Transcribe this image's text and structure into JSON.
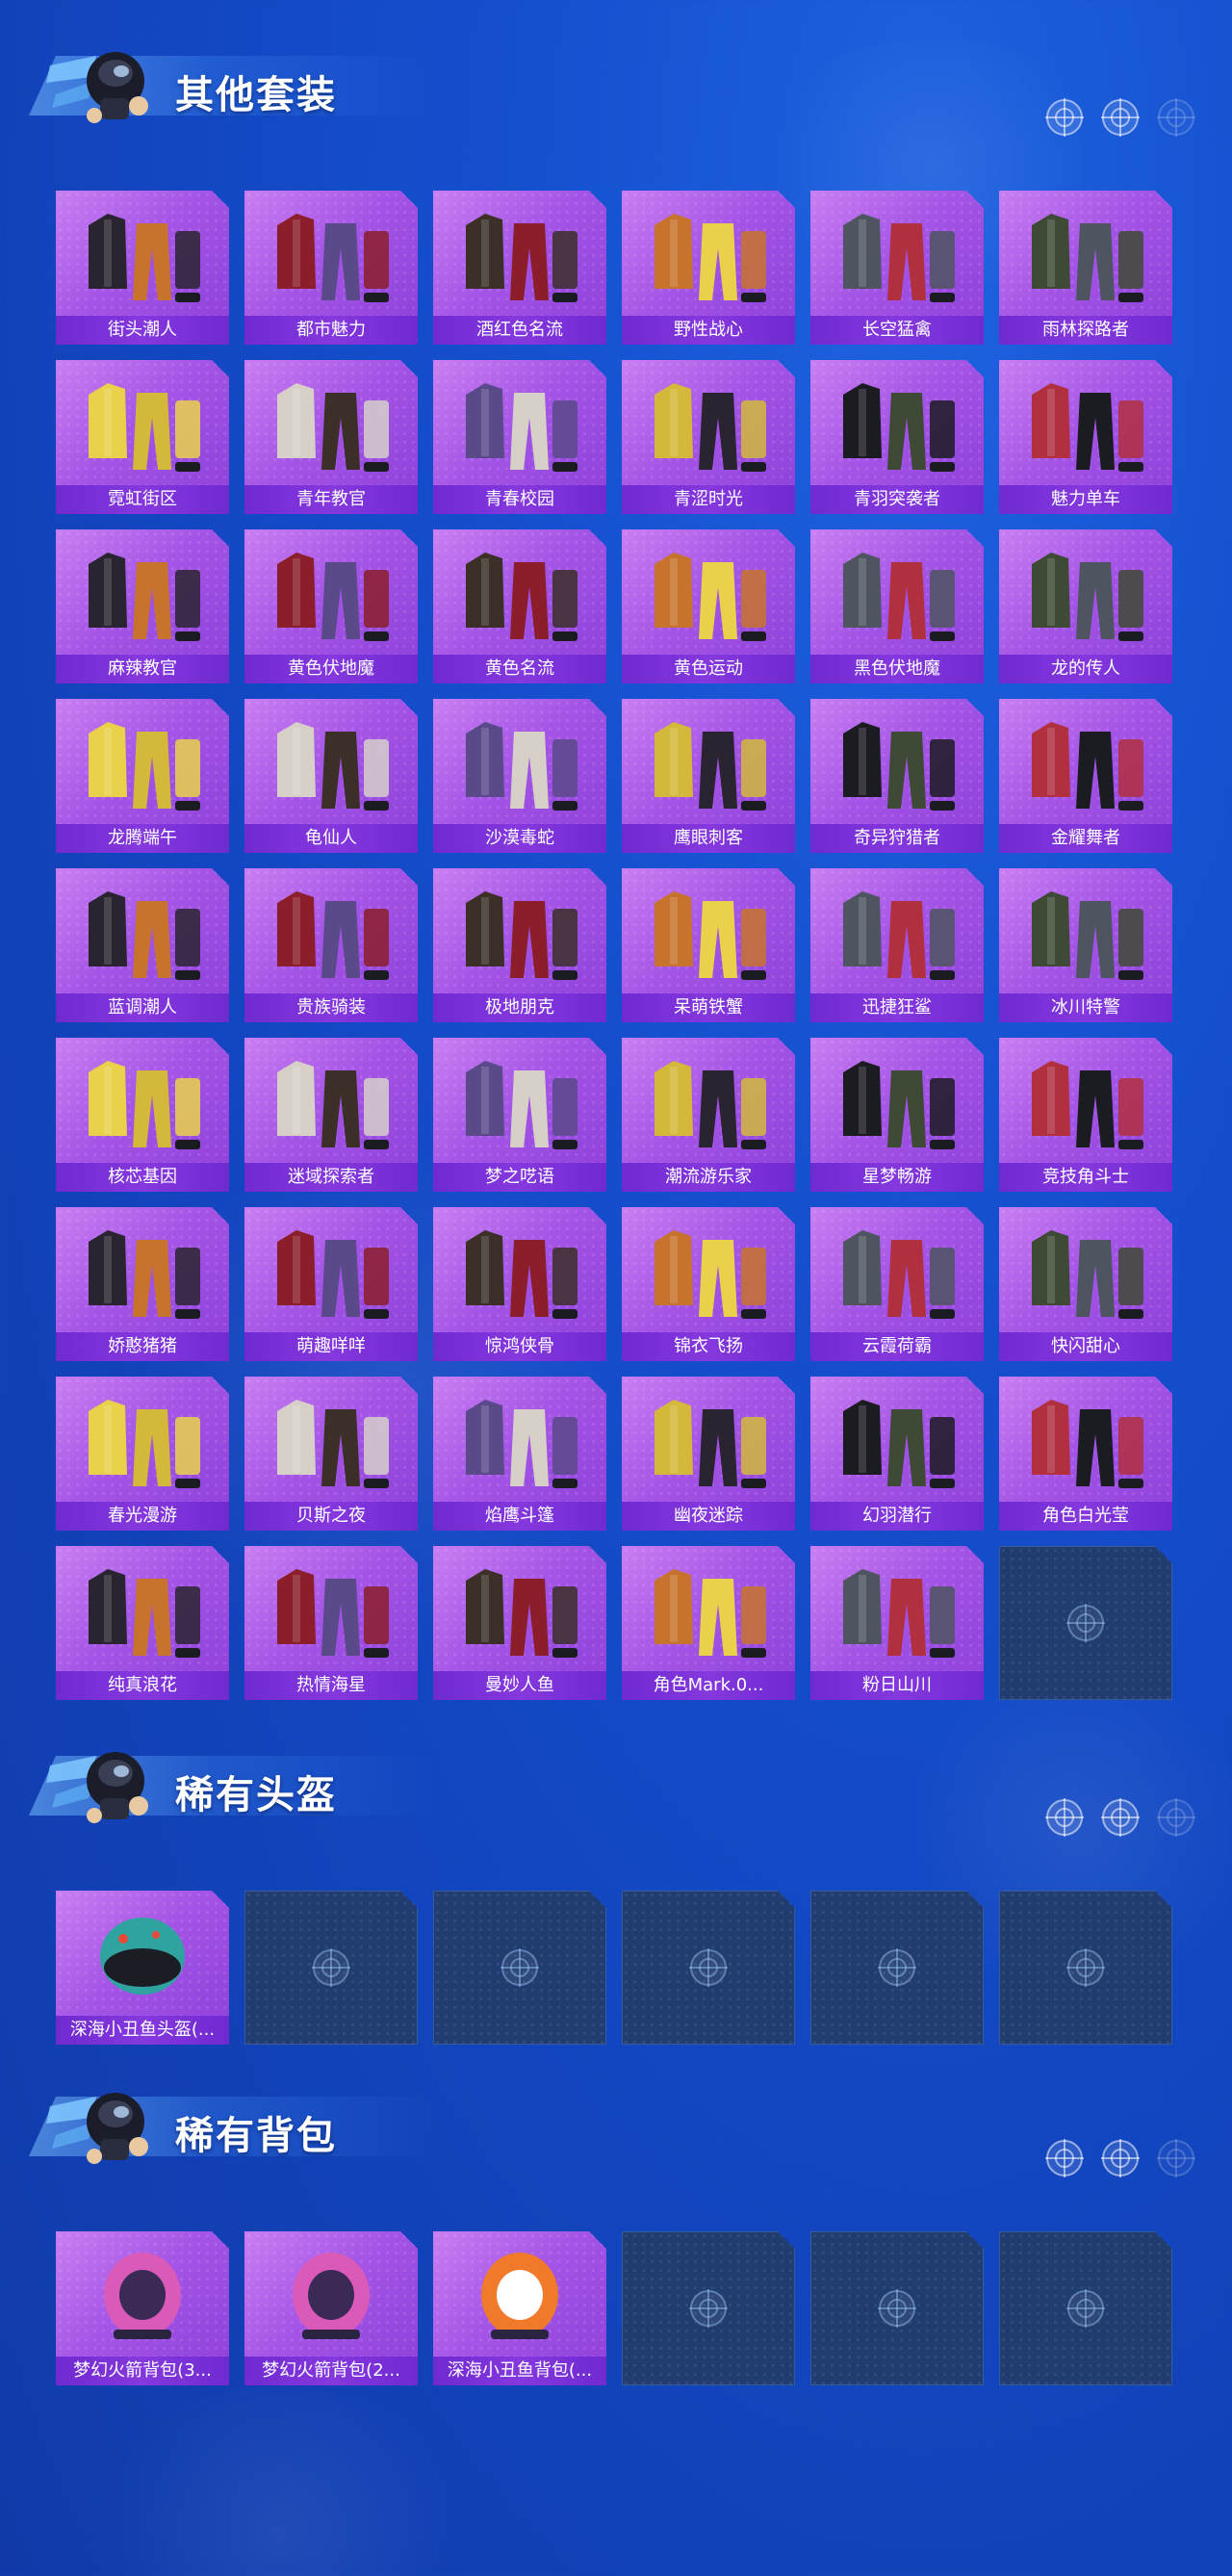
{
  "sections": {
    "outfits": {
      "title": "其他套装",
      "items": [
        "街头潮人",
        "都市魅力",
        "酒红色名流",
        "野性战心",
        "长空猛禽",
        "雨林探路者",
        "霓虹街区",
        "青年教官",
        "青春校园",
        "青涩时光",
        "青羽突袭者",
        "魅力单车",
        "麻辣教官",
        "黄色伏地魔",
        "黄色名流",
        "黄色运动",
        "黑色伏地魔",
        "龙的传人",
        "龙腾端午",
        "龟仙人",
        "沙漠毒蛇",
        "鹰眼刺客",
        "奇异狩猎者",
        "金耀舞者",
        "蓝调潮人",
        "贵族骑装",
        "极地朋克",
        "呆萌铁蟹",
        "迅捷狂鲨",
        "冰川特警",
        "核芯基因",
        "迷域探索者",
        "梦之呓语",
        "潮流游乐家",
        "星梦畅游",
        "竞技角斗士",
        "娇憨猪猪",
        "萌趣咩咩",
        "惊鸿侠骨",
        "锦衣飞扬",
        "云霞荷霸",
        "快闪甜心",
        "春光漫游",
        "贝斯之夜",
        "焰鹰斗篷",
        "幽夜迷踪",
        "幻羽潜行",
        "角色白光莹",
        "纯真浪花",
        "热情海星",
        "曼妙人鱼",
        "角色Mark.0...",
        "粉日山川"
      ],
      "empty_slots": 1
    },
    "helmets": {
      "title": "稀有头盔",
      "items": [
        "深海小丑鱼头盔(..."
      ],
      "empty_slots": 5
    },
    "backpacks": {
      "title": "稀有背包",
      "items": [
        "梦幻火箭背包(3...",
        "梦幻火箭背包(2...",
        "深海小丑鱼背包(..."
      ],
      "empty_slots": 3
    }
  },
  "icons": {
    "mascot": "skydiver-mascot-icon",
    "header": "crosshair-icon",
    "placeholder": "crosshair-icon",
    "item": "outfit-icon"
  },
  "colors": {
    "card_bg": "#a455e6",
    "card_label_bg": "#7a30d8",
    "empty_bg": "#203c70",
    "page_bg": "#1550cf"
  }
}
